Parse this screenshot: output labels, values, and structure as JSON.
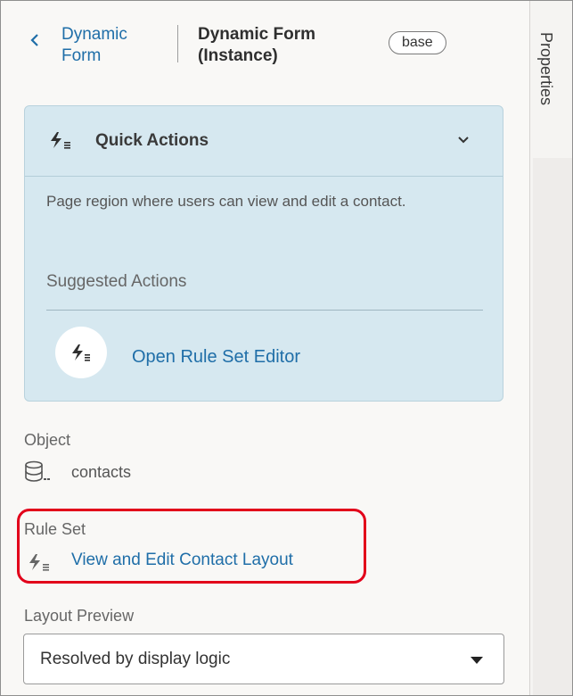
{
  "header": {
    "back_label": "Dynamic Form",
    "title": "Dynamic Form (Instance)",
    "badge": "base"
  },
  "side_tab": {
    "label": "Properties"
  },
  "quick_actions": {
    "title": "Quick Actions",
    "description": "Page region where users can view and edit a contact.",
    "suggested_label": "Suggested Actions",
    "actions": [
      {
        "label": "Open Rule Set Editor",
        "icon": "rule-set-icon"
      }
    ],
    "background_color": "#d6e8f0"
  },
  "object": {
    "label": "Object",
    "value": "contacts",
    "icon": "database-icon"
  },
  "rule_set": {
    "label": "Rule Set",
    "value": "View and Edit Contact Layout",
    "icon": "rule-set-icon",
    "highlight_color": "#e2001a"
  },
  "layout_preview": {
    "label": "Layout Preview",
    "selected": "Resolved by display logic"
  },
  "colors": {
    "link": "#1f6ea8"
  }
}
